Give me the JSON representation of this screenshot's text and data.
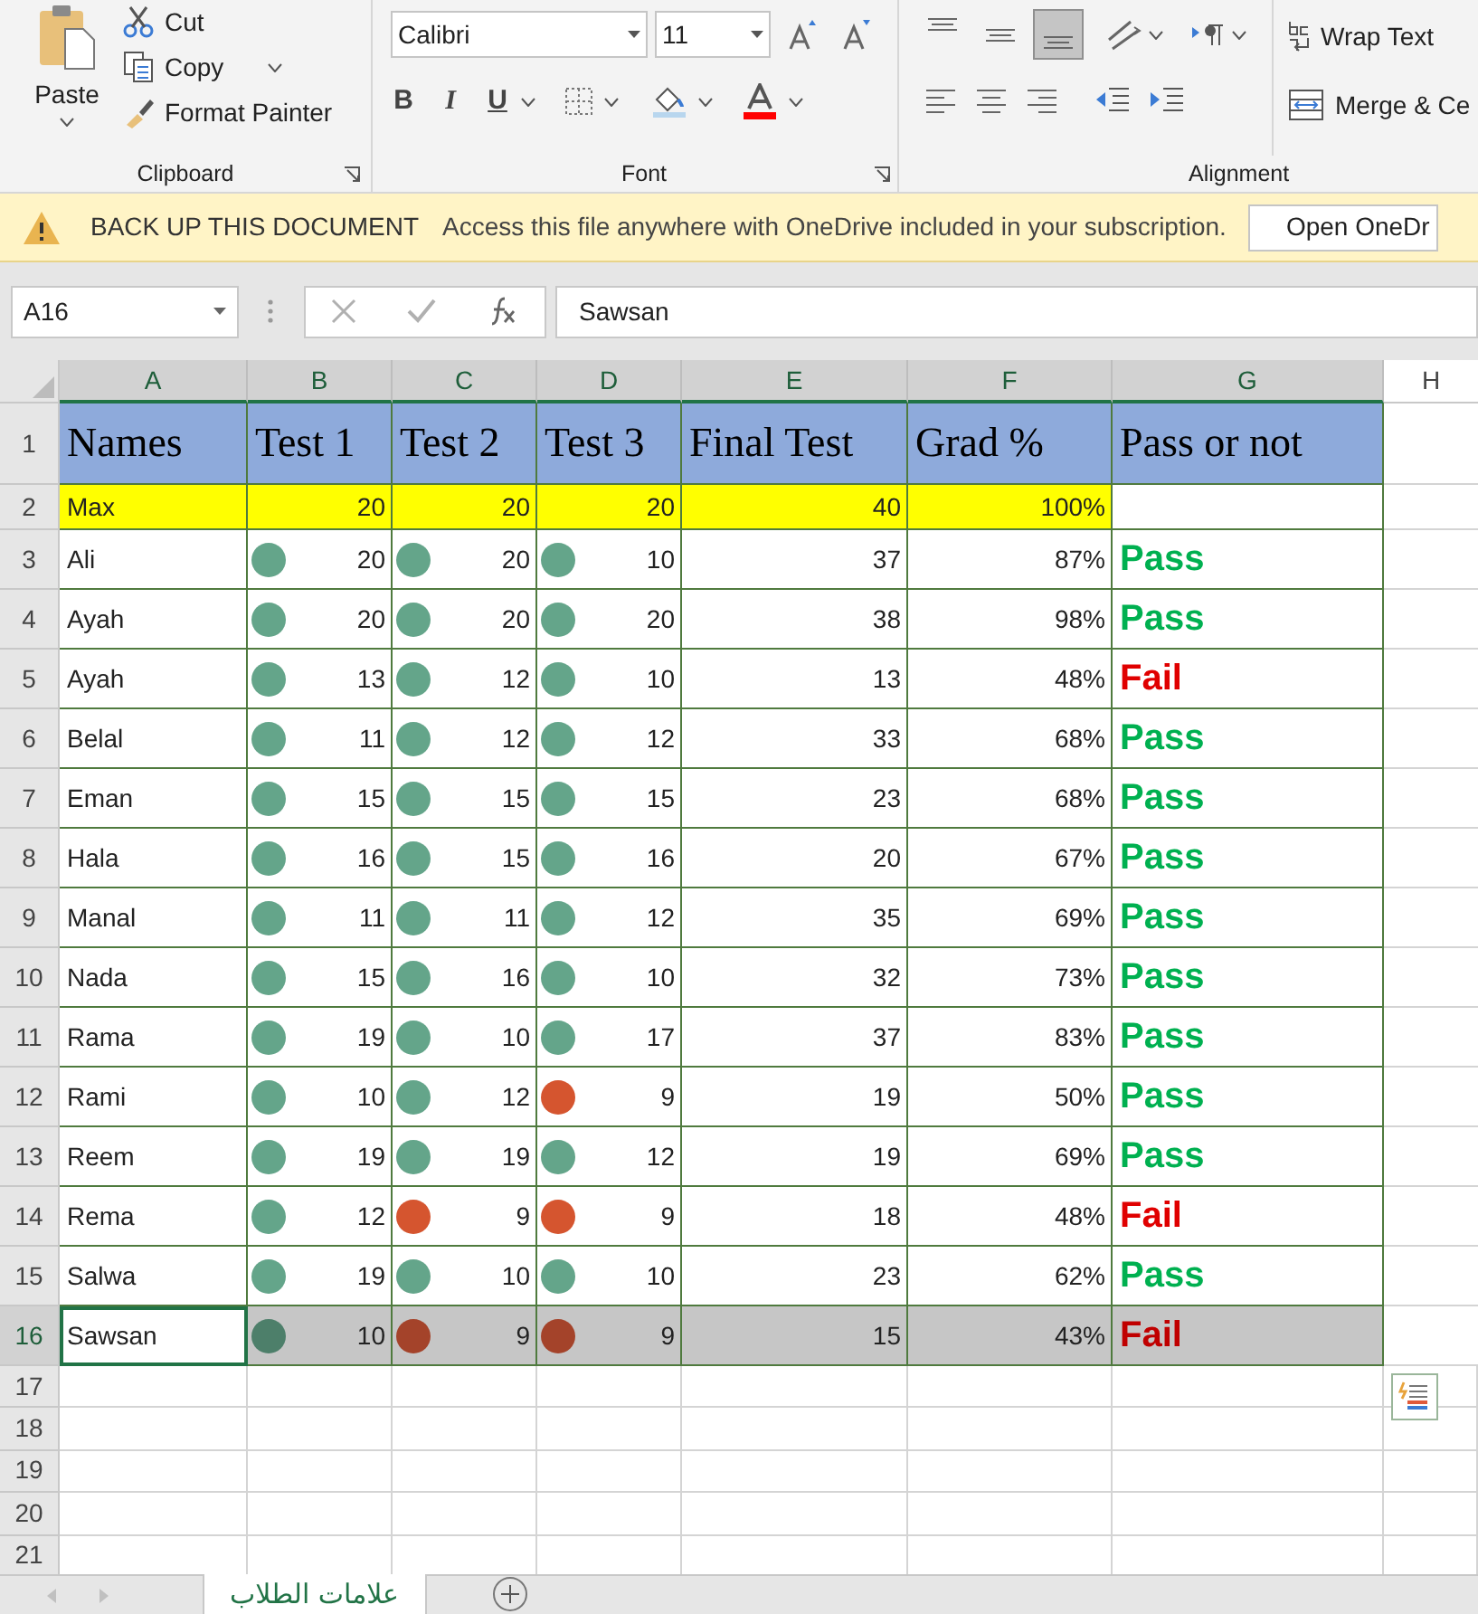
{
  "ribbon": {
    "clipboard": {
      "paste": "Paste",
      "cut": "Cut",
      "copy": "Copy",
      "format_painter": "Format Painter",
      "label": "Clipboard"
    },
    "font": {
      "name": "Calibri",
      "size": "11",
      "bold": "B",
      "italic": "I",
      "underline": "U",
      "label": "Font"
    },
    "alignment": {
      "vertical": [
        {
          "selected": false
        },
        {
          "selected": false
        },
        {
          "selected": true
        }
      ],
      "wrap_text": "Wrap Text",
      "merge": "Merge & Ce",
      "label": "Alignment"
    }
  },
  "notice": {
    "title": "BACK UP THIS DOCUMENT",
    "message": "Access this file anywhere with OneDrive included in your subscription.",
    "button": "Open OneDr"
  },
  "formula_bar": {
    "name_box": "A16",
    "formula": "Sawsan"
  },
  "columns": [
    "A",
    "B",
    "C",
    "D",
    "E",
    "F",
    "G",
    "H"
  ],
  "header_row": {
    "row": "1",
    "cells": [
      "Names",
      "Test 1",
      "Test 2",
      "Test 3",
      "Final Test",
      "Grad %",
      "Pass or not"
    ]
  },
  "max_row": {
    "row": "2",
    "name": "Max",
    "scores": [
      "20",
      "20",
      "20"
    ],
    "final": "40",
    "grade": "100%"
  },
  "rows": [
    {
      "row": "3",
      "name": "Ali",
      "scores": [
        {
          "value": "20",
          "color": "#64a58a"
        },
        {
          "value": "20",
          "color": "#64a58a"
        },
        {
          "value": "10",
          "color": "#64a58a"
        }
      ],
      "final": "37",
      "grade": "87%",
      "result": "Pass",
      "passed": true,
      "selected": false
    },
    {
      "row": "4",
      "name": "Ayah",
      "scores": [
        {
          "value": "20",
          "color": "#64a58a"
        },
        {
          "value": "20",
          "color": "#64a58a"
        },
        {
          "value": "20",
          "color": "#64a58a"
        }
      ],
      "final": "38",
      "grade": "98%",
      "result": "Pass",
      "passed": true,
      "selected": false
    },
    {
      "row": "5",
      "name": "Ayah",
      "scores": [
        {
          "value": "13",
          "color": "#64a58a"
        },
        {
          "value": "12",
          "color": "#64a58a"
        },
        {
          "value": "10",
          "color": "#64a58a"
        }
      ],
      "final": "13",
      "grade": "48%",
      "result": "Fail",
      "passed": false,
      "selected": false
    },
    {
      "row": "6",
      "name": "Belal",
      "scores": [
        {
          "value": "11",
          "color": "#64a58a"
        },
        {
          "value": "12",
          "color": "#64a58a"
        },
        {
          "value": "12",
          "color": "#64a58a"
        }
      ],
      "final": "33",
      "grade": "68%",
      "result": "Pass",
      "passed": true,
      "selected": false
    },
    {
      "row": "7",
      "name": "Eman",
      "scores": [
        {
          "value": "15",
          "color": "#64a58a"
        },
        {
          "value": "15",
          "color": "#64a58a"
        },
        {
          "value": "15",
          "color": "#64a58a"
        }
      ],
      "final": "23",
      "grade": "68%",
      "result": "Pass",
      "passed": true,
      "selected": false
    },
    {
      "row": "8",
      "name": "Hala",
      "scores": [
        {
          "value": "16",
          "color": "#64a58a"
        },
        {
          "value": "15",
          "color": "#64a58a"
        },
        {
          "value": "16",
          "color": "#64a58a"
        }
      ],
      "final": "20",
      "grade": "67%",
      "result": "Pass",
      "passed": true,
      "selected": false
    },
    {
      "row": "9",
      "name": "Manal",
      "scores": [
        {
          "value": "11",
          "color": "#64a58a"
        },
        {
          "value": "11",
          "color": "#64a58a"
        },
        {
          "value": "12",
          "color": "#64a58a"
        }
      ],
      "final": "35",
      "grade": "69%",
      "result": "Pass",
      "passed": true,
      "selected": false
    },
    {
      "row": "10",
      "name": "Nada",
      "scores": [
        {
          "value": "15",
          "color": "#64a58a"
        },
        {
          "value": "16",
          "color": "#64a58a"
        },
        {
          "value": "10",
          "color": "#64a58a"
        }
      ],
      "final": "32",
      "grade": "73%",
      "result": "Pass",
      "passed": true,
      "selected": false
    },
    {
      "row": "11",
      "name": "Rama",
      "scores": [
        {
          "value": "19",
          "color": "#64a58a"
        },
        {
          "value": "10",
          "color": "#64a58a"
        },
        {
          "value": "17",
          "color": "#64a58a"
        }
      ],
      "final": "37",
      "grade": "83%",
      "result": "Pass",
      "passed": true,
      "selected": false
    },
    {
      "row": "12",
      "name": "Rami",
      "scores": [
        {
          "value": "10",
          "color": "#64a58a"
        },
        {
          "value": "12",
          "color": "#64a58a"
        },
        {
          "value": "9",
          "color": "#d5552f"
        }
      ],
      "final": "19",
      "grade": "50%",
      "result": "Pass",
      "passed": true,
      "selected": false
    },
    {
      "row": "13",
      "name": "Reem",
      "scores": [
        {
          "value": "19",
          "color": "#64a58a"
        },
        {
          "value": "19",
          "color": "#64a58a"
        },
        {
          "value": "12",
          "color": "#64a58a"
        }
      ],
      "final": "19",
      "grade": "69%",
      "result": "Pass",
      "passed": true,
      "selected": false
    },
    {
      "row": "14",
      "name": "Rema",
      "scores": [
        {
          "value": "12",
          "color": "#64a58a"
        },
        {
          "value": "9",
          "color": "#d5552f"
        },
        {
          "value": "9",
          "color": "#d5552f"
        }
      ],
      "final": "18",
      "grade": "48%",
      "result": "Fail",
      "passed": false,
      "selected": false
    },
    {
      "row": "15",
      "name": "Salwa",
      "scores": [
        {
          "value": "19",
          "color": "#64a58a"
        },
        {
          "value": "10",
          "color": "#64a58a"
        },
        {
          "value": "10",
          "color": "#64a58a"
        }
      ],
      "final": "23",
      "grade": "62%",
      "result": "Pass",
      "passed": true,
      "selected": false
    },
    {
      "row": "16",
      "name": "Sawsan",
      "scores": [
        {
          "value": "10",
          "color": "#4d7f6a"
        },
        {
          "value": "9",
          "color": "#a4432a"
        },
        {
          "value": "9",
          "color": "#a4432a"
        }
      ],
      "final": "15",
      "grade": "43%",
      "result": "Fail",
      "passed": false,
      "selected": true
    }
  ],
  "empty_rows": [
    "17",
    "18",
    "19",
    "20",
    "21"
  ],
  "sheet_tabs": [
    {
      "label": "علامات الطلاب",
      "selected": true
    }
  ]
}
